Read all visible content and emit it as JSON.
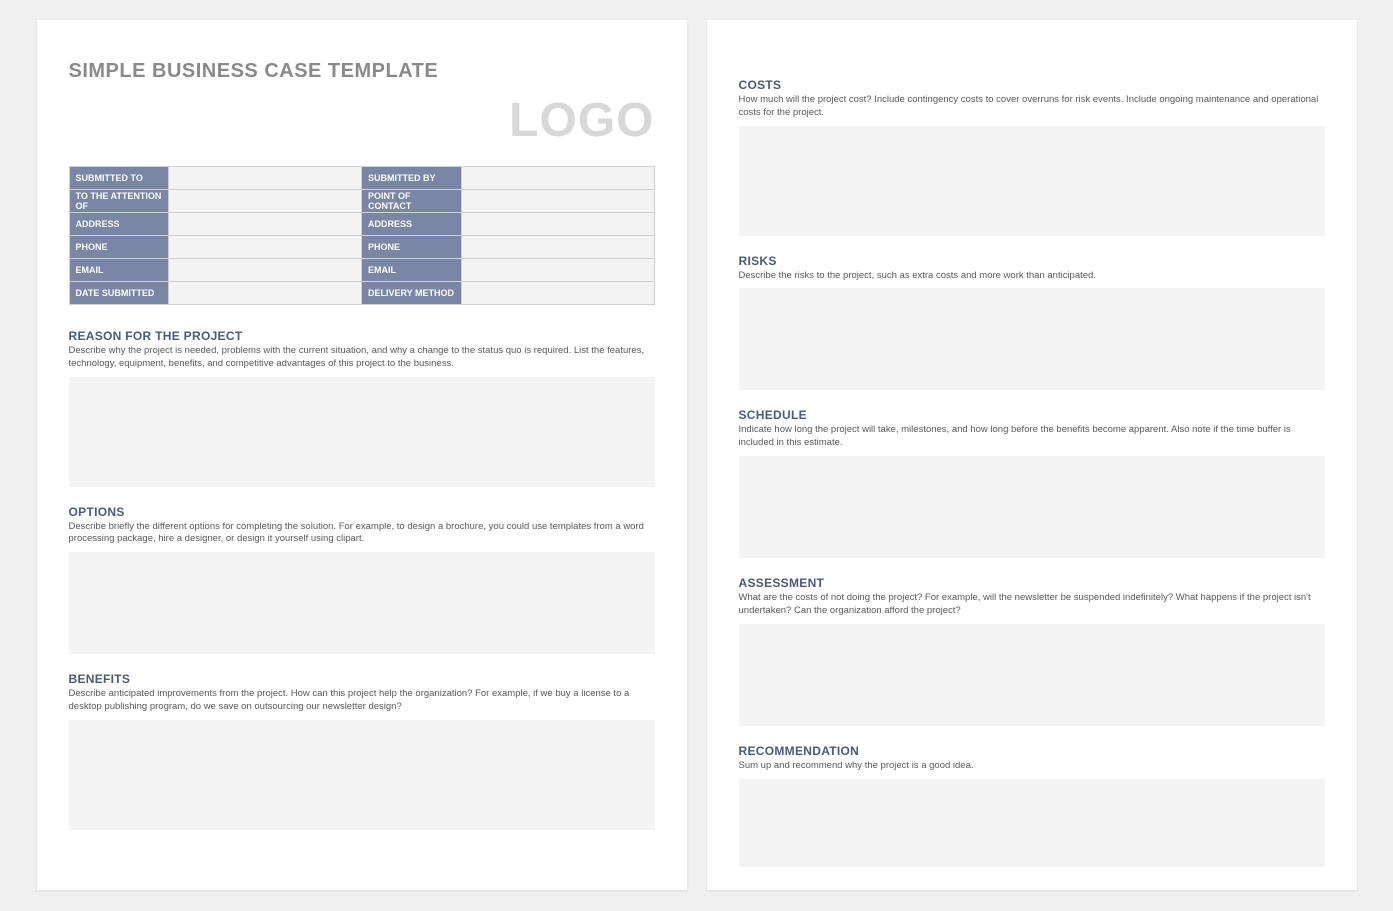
{
  "docTitle": "SIMPLE BUSINESS CASE TEMPLATE",
  "logoText": "LOGO",
  "infoRows": [
    {
      "l1": "SUBMITTED TO",
      "v1": "",
      "l2": "SUBMITTED BY",
      "v2": ""
    },
    {
      "l1": "TO THE ATTENTION OF",
      "v1": "",
      "l2": "POINT OF CONTACT",
      "v2": ""
    },
    {
      "l1": "ADDRESS",
      "v1": "",
      "l2": "ADDRESS",
      "v2": ""
    },
    {
      "l1": "PHONE",
      "v1": "",
      "l2": "PHONE",
      "v2": ""
    },
    {
      "l1": "EMAIL",
      "v1": "",
      "l2": "EMAIL",
      "v2": ""
    },
    {
      "l1": "DATE SUBMITTED",
      "v1": "",
      "l2": "DELIVERY METHOD",
      "v2": ""
    }
  ],
  "sections": {
    "reason": {
      "title": "REASON FOR THE PROJECT",
      "desc": "Describe why the project is needed, problems with the current situation, and why a change to the status quo is required. List the features, technology, equipment, benefits, and competitive advantages of this project to the business."
    },
    "options": {
      "title": "OPTIONS",
      "desc": "Describe briefly the different options for completing the solution. For example, to design a brochure, you could use templates from a word processing package, hire a designer, or design it yourself using clipart."
    },
    "benefits": {
      "title": "BENEFITS",
      "desc": "Describe anticipated improvements from the project. How can this project help the organization? For example, if we buy a license to a desktop publishing program, do we save on outsourcing our newsletter design?"
    },
    "costs": {
      "title": "COSTS",
      "desc": "How much will the project cost? Include contingency costs to cover overruns for risk events. Include ongoing maintenance and operational costs for the project."
    },
    "risks": {
      "title": "RISKS",
      "desc": "Describe the risks to the project, such as extra costs and more work than anticipated."
    },
    "schedule": {
      "title": "SCHEDULE",
      "desc": "Indicate how long the project will take, milestones, and how long before the benefits become apparent. Also note if the time buffer is included in this estimate."
    },
    "assessment": {
      "title": "ASSESSMENT",
      "desc": "What are the costs of not doing the project? For example, will the newsletter be suspended indefinitely? What happens if the project isn't undertaken? Can the organization afford the project?"
    },
    "recommendation": {
      "title": "RECOMMENDATION",
      "desc": "Sum up and recommend why the project is a good idea."
    }
  }
}
